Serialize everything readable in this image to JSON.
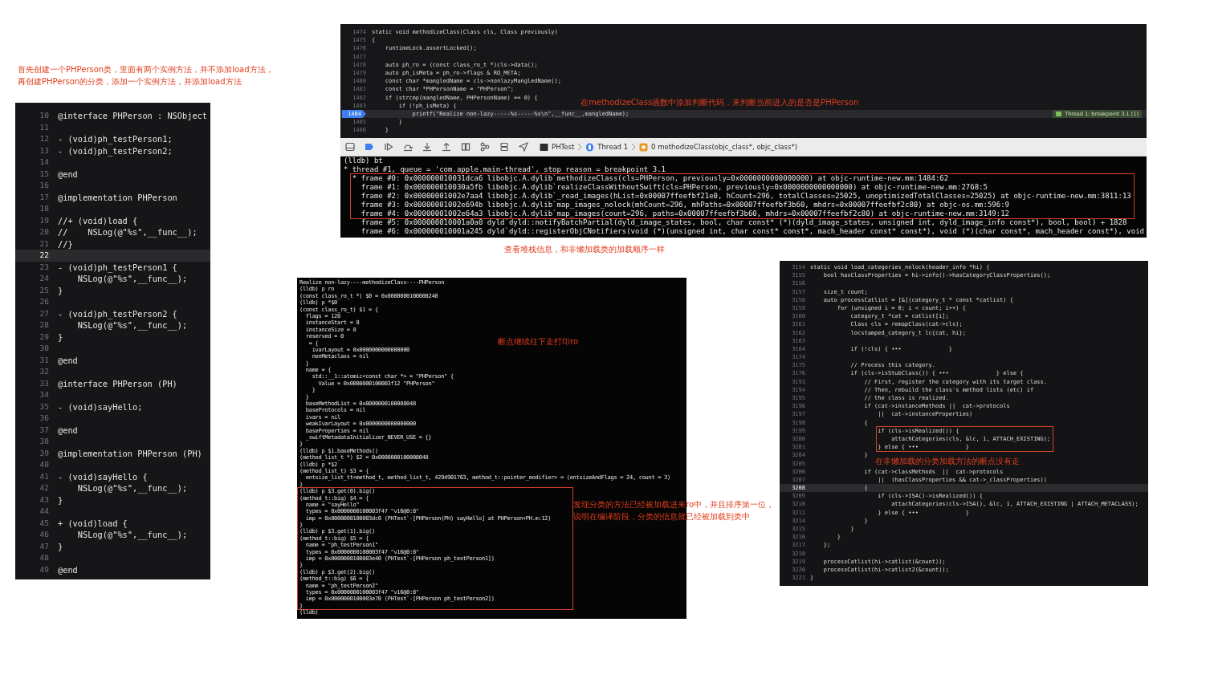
{
  "notes": [
    {
      "text": "首先创建一个PHPerson类，里面有两个实例方法，并不添加load方法，"
    },
    {
      "text": "再创建PHPerson的分类，添加一个实例方法，并添加load方法"
    },
    {
      "text": "在methodizeClass函数中添加判断代码，来判断当前进入的是否是PHPerson"
    },
    {
      "text": "查看堆栈信息，和非懒加载类的加载顺序一样"
    },
    {
      "text": "断点继续往下走打印ro"
    },
    {
      "text": "发现分类的方法已经被加载进来ro中，并且排序第一位，"
    },
    {
      "text": "说明在编译阶段，分类的信息就已经被加载到类中"
    },
    {
      "text": "在非懒加载的分类加载方法的断点没有走"
    }
  ],
  "class_source": {
    "blocks": [
      {
        "boxed": false,
        "lines": [
          {
            "n": "10",
            "text": "@interface PHPerson : NSObject",
            "current": false
          },
          {
            "n": "11",
            "current": false
          },
          {
            "n": "12",
            "text": "- (void)ph_testPerson1;",
            "current": false
          },
          {
            "n": "13",
            "text": "- (void)ph_testPerson2;",
            "current": false
          },
          {
            "n": "14",
            "current": false
          },
          {
            "n": "15",
            "text": "@end",
            "current": false
          },
          {
            "n": "16",
            "current": false
          },
          {
            "n": "17",
            "text": "@implementation PHPerson",
            "current": false
          },
          {
            "n": "18",
            "current": false
          },
          {
            "n": "19",
            "text": "//+ (void)load {",
            "current": false
          },
          {
            "n": "20",
            "text": "//    NSLog(@\"%s\",__func__);",
            "current": false
          },
          {
            "n": "21",
            "text": "//}",
            "current": false
          },
          {
            "n": "22",
            "current": true
          },
          {
            "n": "23",
            "text": "- (void)ph_testPerson1 {",
            "current": false
          },
          {
            "n": "24",
            "text": "    NSLog(@\"%s\",__func__);",
            "current": false
          },
          {
            "n": "25",
            "text": "}",
            "current": false
          },
          {
            "n": "26",
            "current": false
          },
          {
            "n": "27",
            "text": "- (void)ph_testPerson2 {",
            "current": false
          },
          {
            "n": "28",
            "text": "    NSLog(@\"%s\",__func__);",
            "current": false
          },
          {
            "n": "29",
            "text": "}",
            "current": false
          },
          {
            "n": "30",
            "current": false
          },
          {
            "n": "31",
            "text": "@end",
            "current": false
          },
          {
            "n": "32",
            "current": false
          },
          {
            "n": "33",
            "text": "@interface PHPerson (PH)",
            "current": false
          },
          {
            "n": "34",
            "current": false
          },
          {
            "n": "35",
            "text": "- (void)sayHello;",
            "current": false
          },
          {
            "n": "36",
            "current": false
          },
          {
            "n": "37",
            "text": "@end",
            "current": false
          },
          {
            "n": "38",
            "current": false
          },
          {
            "n": "39",
            "text": "@implementation PHPerson (PH)",
            "current": false
          },
          {
            "n": "40",
            "current": false
          },
          {
            "n": "41",
            "text": "- (void)sayHello {",
            "current": false
          },
          {
            "n": "42",
            "text": "    NSLog(@\"%s\",__func__);",
            "current": false
          },
          {
            "n": "43",
            "text": "}",
            "current": false
          },
          {
            "n": "44",
            "current": false
          },
          {
            "n": "45",
            "text": "+ (void)load {",
            "current": false
          },
          {
            "n": "46",
            "text": "    NSLog(@\"%s\",__func__);",
            "current": false
          },
          {
            "n": "47",
            "text": "}",
            "current": false
          },
          {
            "n": "48",
            "current": false
          },
          {
            "n": "49",
            "text": "@end",
            "current": false
          }
        ]
      }
    ]
  },
  "runtime_source": {
    "breakpoint_badge": "Thread 1: breakpoint 3.1 (1)",
    "blocks": [
      {
        "boxed": false,
        "lines": [
          {
            "n": "1474",
            "text": "static void methodizeClass(Class cls, Class previously)",
            "current": false
          },
          {
            "n": "1475",
            "text": "{",
            "current": false
          },
          {
            "n": "1476",
            "text": "    runtimeLock.assertLocked();",
            "current": false
          },
          {
            "n": "1477",
            "current": false
          },
          {
            "n": "1478",
            "text": "    auto ph_ro = (const class_ro_t *)cls->data();",
            "current": false
          },
          {
            "n": "1479",
            "text": "    auto ph_isMeta = ph_ro->flags & RO_META;",
            "current": false
          },
          {
            "n": "1480",
            "text": "    const char *mangledName = cls->nonlazyMangledName();",
            "current": false
          },
          {
            "n": "1481",
            "text": "    const char *PHPersonName = \"PHPerson\";",
            "current": false
          },
          {
            "n": "1482",
            "text": "    if (strcmp(mangledName, PHPersonName) == 0) {",
            "current": false
          },
          {
            "n": "1483",
            "text": "        if (!ph_isMeta) {",
            "current": false
          },
          {
            "n": "1484",
            "text": "            printf(\"Realize non-lazy-----%s-----%s\\n\",__func__,mangledName);",
            "current": true
          },
          {
            "n": "1485",
            "text": "        }",
            "current": false
          },
          {
            "n": "1486",
            "text": "    }",
            "current": false
          }
        ]
      }
    ]
  },
  "debug_bar": {
    "breadcrumb": [
      {
        "text": "PHTest"
      },
      {
        "text": "Thread 1"
      },
      {
        "text": "0 methodizeClass(objc_class*, objc_class*)"
      }
    ]
  },
  "backtrace": {
    "blocks": [
      {
        "boxed": false,
        "lines": [
          {
            "text": "(lldb) bt"
          },
          {
            "text": "* thread #1, queue = 'com.apple.main-thread', stop reason = breakpoint 3.1"
          }
        ]
      },
      {
        "boxed": true,
        "lines": [
          {
            "text": "  * frame #0: 0x000000010031dca6 libobjc.A.dylib`methodizeClass(cls=PHPerson, previously=0x0000000000000000) at objc-runtime-new.mm:1484:62"
          },
          {
            "text": "    frame #1: 0x000000010030a5fb libobjc.A.dylib`realizeClassWithoutSwift(cls=PHPerson, previously=0x0000000000000000) at objc-runtime-new.mm:2768:5"
          },
          {
            "text": "    frame #2: 0x00000001002e7aa4 libobjc.A.dylib`_read_images(hList=0x00007ffeefbf21e0, hCount=296, totalClasses=25025, unoptimizedTotalClasses=25025) at objc-runtime-new.mm:3811:13"
          },
          {
            "text": "    frame #3: 0x00000001002e694b libobjc.A.dylib`map_images_nolock(mhCount=296, mhPaths=0x00007ffeefbf3b60, mhdrs=0x00007ffeefbf2c80) at objc-os.mm:596:9"
          },
          {
            "text": "    frame #4: 0x00000001002e64a3 libobjc.A.dylib`map_images(count=296, paths=0x00007ffeefbf3b60, mhdrs=0x00007ffeefbf2c80) at objc-runtime-new.mm:3149:12"
          }
        ]
      },
      {
        "boxed": false,
        "lines": [
          {
            "text": "    frame #5: 0x000000010001a0a0 dyld`dyld::notifyBatchPartial(dyld_image_states, bool, char const* (*)(dyld_image_states, unsigned int, dyld_image_info const*), bool, bool) + 1828"
          },
          {
            "text": "    frame #6: 0x000000010001a245 dyld`dyld::registerObjCNotifiers(void (*)(unsigned int, char const* const*, mach_header const* const*), void (*)(char const*, mach_header const*), void"
          }
        ]
      }
    ]
  },
  "lldb_output": {
    "blocks": [
      {
        "boxed": false,
        "lines": [
          {
            "text": "Realize non-lazy----methodizeClass----PHPerson"
          },
          {
            "text": "(lldb) p ro"
          },
          {
            "text": "(const class_ro_t *) $0 = 0x0000000100008240"
          },
          {
            "text": "(lldb) p *$0"
          },
          {
            "text": "(const class_ro_t) $1 = {"
          },
          {
            "text": "  flags = 128"
          },
          {
            "text": "  instanceStart = 8"
          },
          {
            "text": "  instanceSize = 8"
          },
          {
            "text": "  reserved = 0"
          },
          {
            "text": "   = {"
          },
          {
            "text": "    ivarLayout = 0x0000000000000000"
          },
          {
            "text": "    nonMetaclass = nil"
          },
          {
            "text": "  }"
          },
          {
            "text": "  name = {"
          },
          {
            "text": "    std::__1::atomic<const char *> = \"PHPerson\" {"
          },
          {
            "text": "      Value = 0x0000000100003f12 \"PHPerson\""
          },
          {
            "text": "    }"
          },
          {
            "text": "  }"
          },
          {
            "text": "  baseMethodList = 0x0000000100008048"
          },
          {
            "text": "  baseProtocols = nil"
          },
          {
            "text": "  ivars = nil"
          },
          {
            "text": "  weakIvarLayout = 0x0000000000000000"
          },
          {
            "text": "  baseProperties = nil"
          },
          {
            "text": "  _swiftMetadataInitializer_NEVER_USE = {}"
          },
          {
            "text": "}"
          },
          {
            "text": "(lldb) p $1.baseMethods()"
          },
          {
            "text": "(method_list_t *) $2 = 0x0000000100008048"
          },
          {
            "text": "(lldb) p *$2"
          },
          {
            "text": "(method_list_t) $3 = {"
          },
          {
            "text": "  entsize_list_tt<method_t, method_list_t, 4294901763, method_t::pointer_modifier> = (entsizeAndFlags = 24, count = 3)"
          },
          {
            "text": "}"
          }
        ]
      },
      {
        "boxed": true,
        "lines": [
          {
            "text": "(lldb) p $3.get(0).big()"
          },
          {
            "text": "(method_t::big) $4 = {"
          },
          {
            "text": "  name = \"sayHello\""
          },
          {
            "text": "  types = 0x0000000100003f47 \"v16@0:8\""
          },
          {
            "text": "  imp = 0x0000000100003dc0 (PHTest`-[PHPerson(PH) sayHello] at PHPerson+PH.m:12)"
          },
          {
            "text": "}"
          },
          {
            "text": "(lldb) p $3.get(1).big()"
          },
          {
            "text": "(method_t::big) $5 = {"
          },
          {
            "text": "  name = \"ph_testPerson1\""
          },
          {
            "text": "  types = 0x0000000100003f47 \"v16@0:8\""
          },
          {
            "text": "  imp = 0x0000000100003e40 (PHTest`-[PHPerson ph_testPerson1])"
          },
          {
            "text": "}"
          },
          {
            "text": "(lldb) p $3.get(2).big()"
          },
          {
            "text": "(method_t::big) $6 = {"
          },
          {
            "text": "  name = \"ph_testPerson2\""
          },
          {
            "text": "  types = 0x0000000100003f47 \"v16@0:8\""
          },
          {
            "text": "  imp = 0x0000000100003e70 (PHTest`-[PHPerson ph_testPerson2])"
          },
          {
            "text": "}"
          }
        ]
      },
      {
        "boxed": false,
        "lines": [
          {
            "text": "(lldb)"
          }
        ]
      }
    ]
  },
  "category_source": {
    "blocks": [
      {
        "boxed": false,
        "lines": [
          {
            "n": "3154",
            "text": "static void load_categories_nolock(header_info *hi) {",
            "current": false
          },
          {
            "n": "3155",
            "text": "    bool hasClassProperties = hi->info()->hasCategoryClassProperties();",
            "current": false
          },
          {
            "n": "3156",
            "current": false
          },
          {
            "n": "3157",
            "text": "    size_t count;",
            "current": false
          },
          {
            "n": "3158",
            "text": "    auto processCatlist = [&](category_t * const *catlist) {",
            "current": false
          },
          {
            "n": "3159",
            "text": "        for (unsigned i = 0; i < count; i++) {",
            "current": false
          },
          {
            "n": "3160",
            "text": "            category_t *cat = catlist[i];",
            "current": false
          },
          {
            "n": "3161",
            "text": "            Class cls = remapClass(cat->cls);",
            "current": false
          },
          {
            "n": "3162",
            "text": "            locstamped_category_t lc{cat, hi};",
            "current": false
          },
          {
            "n": "3163",
            "current": false
          },
          {
            "n": "3164",
            "text": "            if (!cls) { •••              }",
            "current": false
          },
          {
            "n": "3174",
            "current": false
          },
          {
            "n": "3175",
            "text": "            // Process this category.",
            "current": false
          },
          {
            "n": "3176",
            "text": "            if (cls->isStubClass()) { •••              } else {",
            "current": false
          },
          {
            "n": "3193",
            "text": "                // First, register the category with its target class.",
            "current": false
          },
          {
            "n": "3194",
            "text": "                // Then, rebuild the class's method lists (etc) if",
            "current": false
          },
          {
            "n": "3195",
            "text": "                // the class is realized.",
            "current": false
          },
          {
            "n": "3196",
            "text": "                if (cat->instanceMethods ||  cat->protocols",
            "current": false
          },
          {
            "n": "3197",
            "text": "                    ||  cat->instanceProperties)",
            "current": false
          },
          {
            "n": "3198",
            "text": "                {",
            "current": false
          }
        ]
      },
      {
        "boxed": true,
        "lines": [
          {
            "n": "3199",
            "text": "                    if (cls->isRealized()) {",
            "current": false
          },
          {
            "n": "3200",
            "text": "                        attachCategories(cls, &lc, 1, ATTACH_EXISTING);",
            "current": false
          },
          {
            "n": "3201",
            "text": "                    } else { •••              }",
            "current": false
          }
        ]
      },
      {
        "boxed": false,
        "lines": [
          {
            "n": "3204",
            "text": "                }",
            "current": false
          },
          {
            "n": "3205",
            "current": false
          },
          {
            "n": "3206",
            "text": "                if (cat->classMethods  ||  cat->protocols",
            "current": false
          },
          {
            "n": "3207",
            "text": "                    ||  (hasClassProperties && cat->_classProperties))",
            "current": false
          },
          {
            "n": "3208",
            "text": "                {",
            "current": true
          },
          {
            "n": "3209",
            "text": "                    if (cls->ISA()->isRealized()) {",
            "current": false
          },
          {
            "n": "3210",
            "text": "                        attachCategories(cls->ISA(), &lc, 1, ATTACH_EXISTING | ATTACH_METACLASS);",
            "current": false
          },
          {
            "n": "3211",
            "text": "                    } else { •••              }",
            "current": false
          },
          {
            "n": "3214",
            "text": "                }",
            "current": false
          },
          {
            "n": "3215",
            "text": "            }",
            "current": false
          },
          {
            "n": "3216",
            "text": "        }",
            "current": false
          },
          {
            "n": "3217",
            "text": "    };",
            "current": false
          },
          {
            "n": "3218",
            "current": false
          },
          {
            "n": "3219",
            "text": "    processCatlist(hi->catlist(&count));",
            "current": false
          },
          {
            "n": "3220",
            "text": "    processCatlist(hi->catlist2(&count));",
            "current": false
          },
          {
            "n": "3221",
            "text": "}",
            "current": false
          }
        ]
      }
    ]
  }
}
